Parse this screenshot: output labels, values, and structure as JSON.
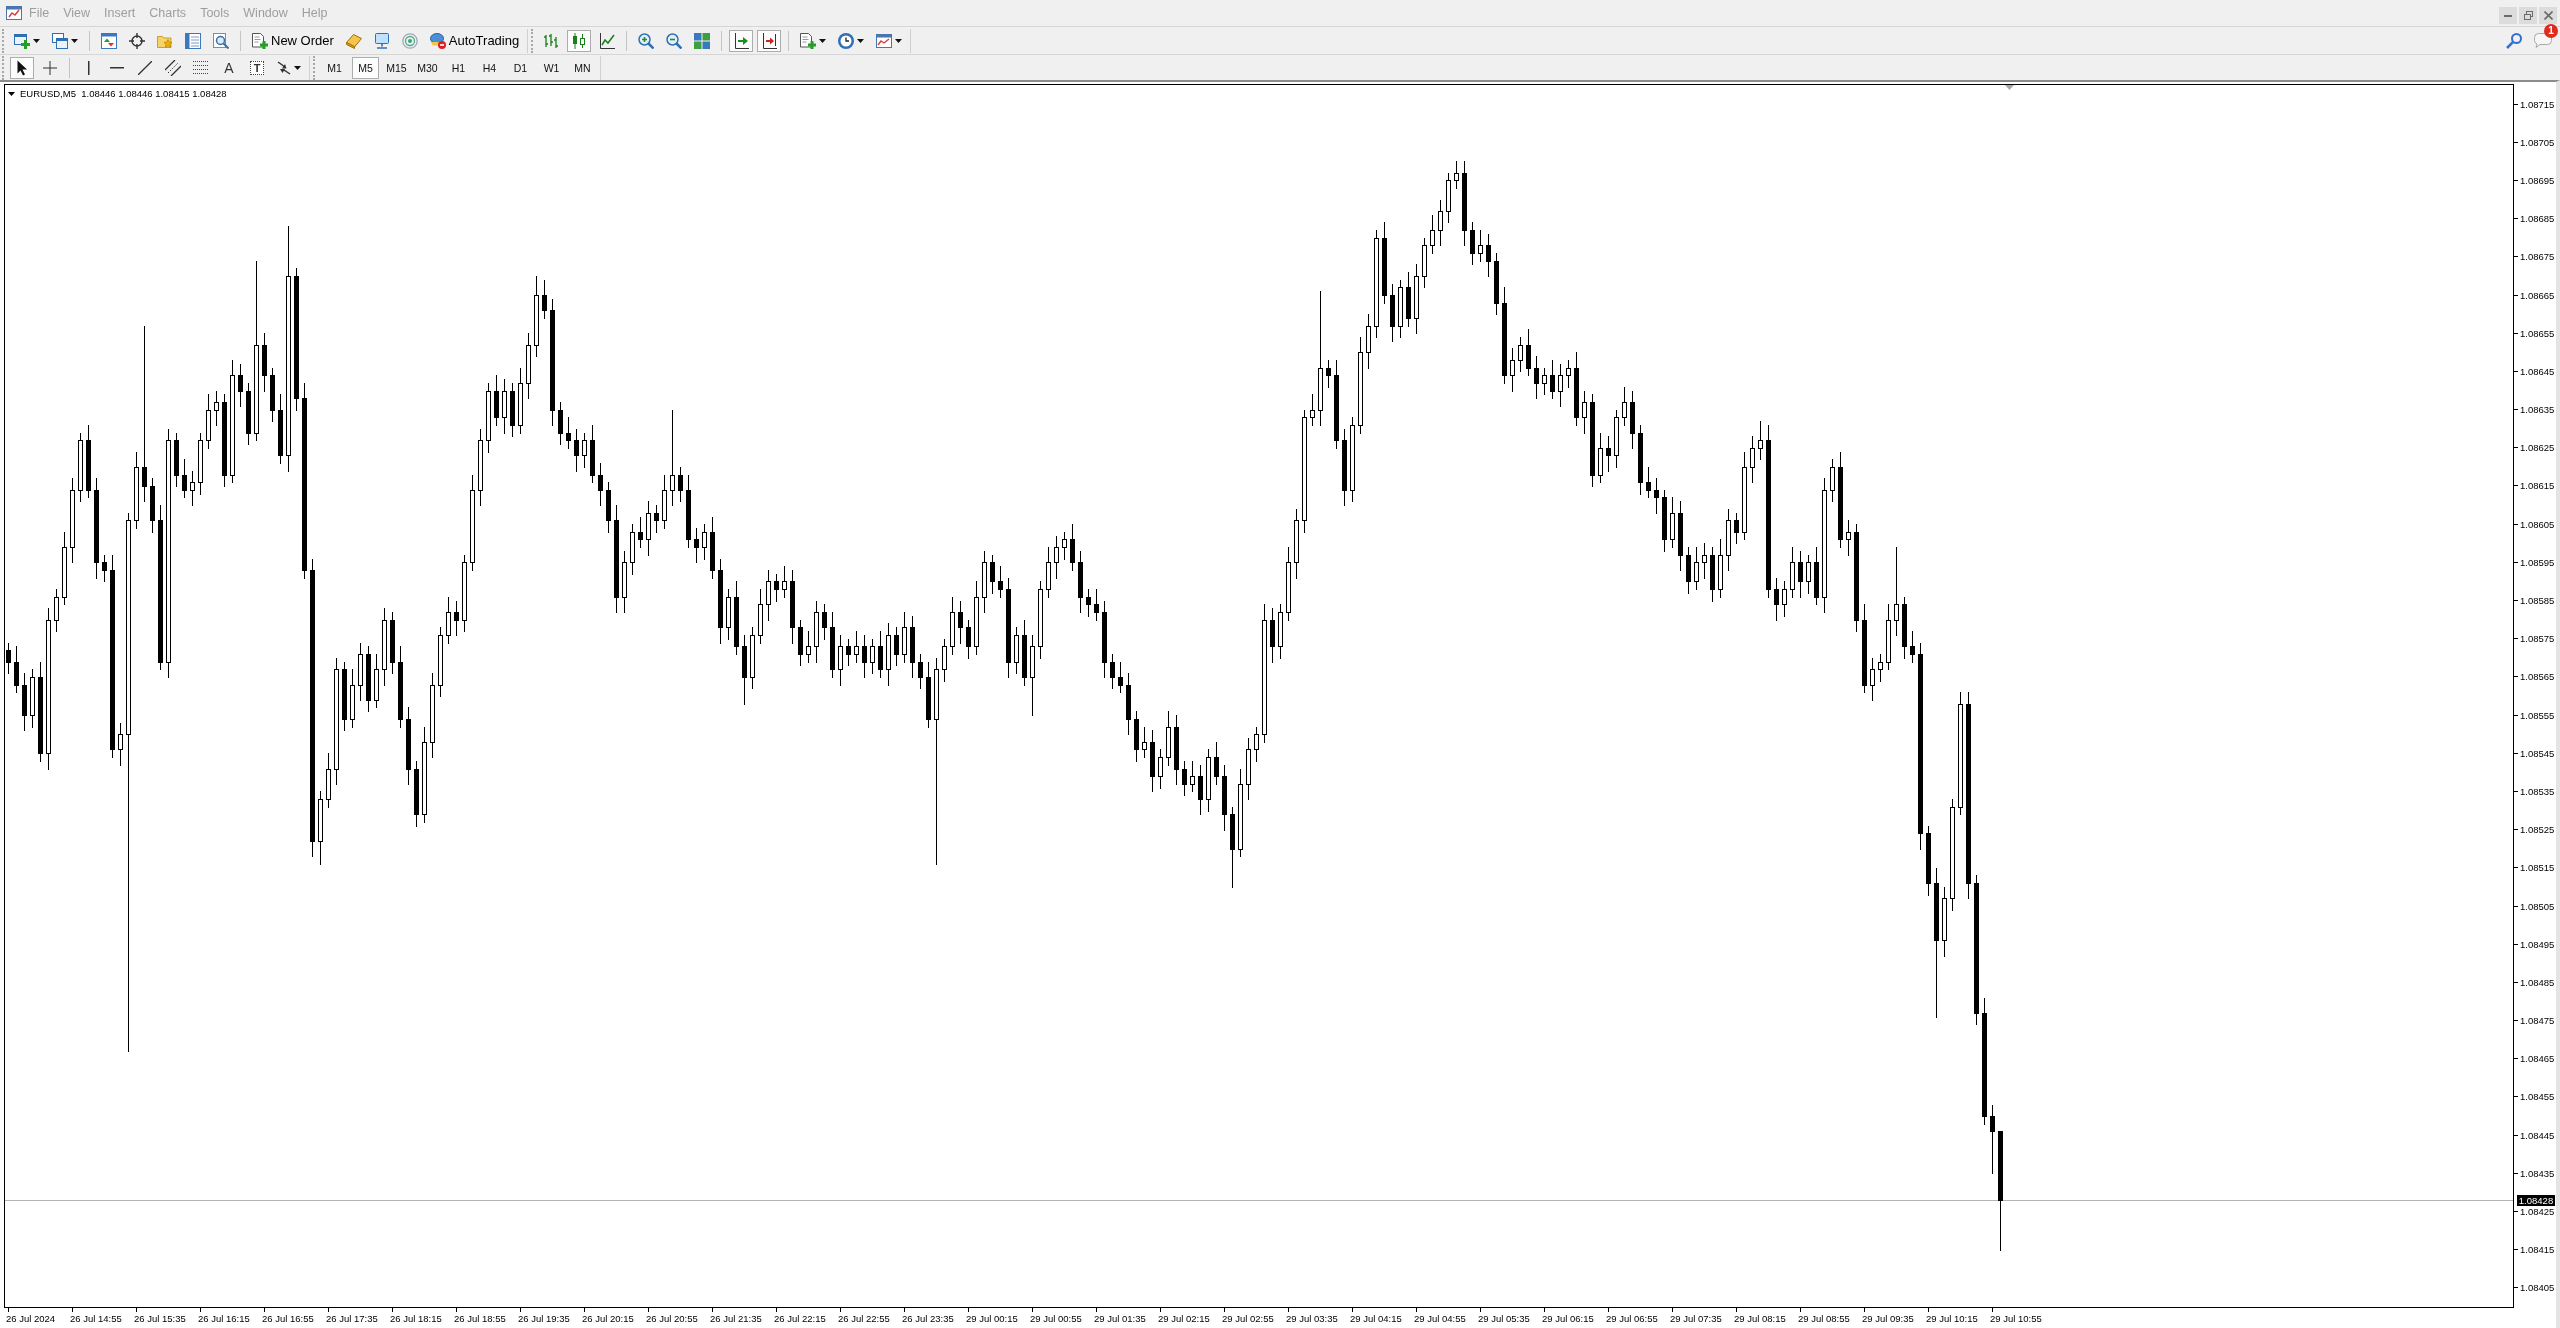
{
  "menu_bar": {
    "items": [
      "File",
      "View",
      "Insert",
      "Charts",
      "Tools",
      "Window",
      "Help"
    ]
  },
  "toolbar": {
    "new_order_button": "New Order",
    "autotrading_button": "AutoTrading",
    "chart_types": [
      {
        "kind": "bars",
        "selected": false
      },
      {
        "kind": "candles",
        "selected": true
      },
      {
        "kind": "line",
        "selected": false
      }
    ],
    "auto_scroll": {
      "on": true
    },
    "chart_shift": {
      "on": true
    }
  },
  "line_studies": {
    "tools": [
      {
        "kind": "cursor",
        "selected": true
      },
      {
        "kind": "crosshair",
        "selected": false
      }
    ],
    "text_tool": "A",
    "text_label_tool": "T"
  },
  "periods": [
    {
      "label": "M1",
      "selected": false
    },
    {
      "label": "M5",
      "selected": true
    },
    {
      "label": "M15",
      "selected": false
    },
    {
      "label": "M30",
      "selected": false
    },
    {
      "label": "H1",
      "selected": false
    },
    {
      "label": "H4",
      "selected": false
    },
    {
      "label": "D1",
      "selected": false
    },
    {
      "label": "W1",
      "selected": false
    },
    {
      "label": "MN",
      "selected": false
    }
  ],
  "notifications": {
    "badge": "1"
  },
  "chart": {
    "header": "EURUSD,M5  1.08446 1.08446 1.08415 1.08428",
    "current_price": "1.08428",
    "price_axis": [
      "1.08715",
      "1.08705",
      "1.08695",
      "1.08685",
      "1.08675",
      "1.08665",
      "1.08655",
      "1.08645",
      "1.08635",
      "1.08625",
      "1.08615",
      "1.08605",
      "1.08595",
      "1.08585",
      "1.08575",
      "1.08565",
      "1.08555",
      "1.08545",
      "1.08535",
      "1.08525",
      "1.08515",
      "1.08505",
      "1.08495",
      "1.08485",
      "1.08475",
      "1.08465",
      "1.08455",
      "1.08445",
      "1.08435",
      "1.08425",
      "1.08415",
      "1.08405"
    ],
    "time_axis": [
      "26 Jul 2024",
      "26 Jul 14:55",
      "26 Jul 15:35",
      "26 Jul 16:15",
      "26 Jul 16:55",
      "26 Jul 17:35",
      "26 Jul 18:15",
      "26 Jul 18:55",
      "26 Jul 19:35",
      "26 Jul 20:15",
      "26 Jul 20:55",
      "26 Jul 21:35",
      "26 Jul 22:15",
      "26 Jul 22:55",
      "26 Jul 23:35",
      "29 Jul 00:15",
      "29 Jul 00:55",
      "29 Jul 01:35",
      "29 Jul 02:15",
      "29 Jul 02:55",
      "29 Jul 03:35",
      "29 Jul 04:15",
      "29 Jul 04:55",
      "29 Jul 05:35",
      "29 Jul 06:15",
      "29 Jul 06:55",
      "29 Jul 07:35",
      "29 Jul 08:15",
      "29 Jul 08:55",
      "29 Jul 09:35",
      "29 Jul 10:15",
      "29 Jul 10:55"
    ]
  }
}
